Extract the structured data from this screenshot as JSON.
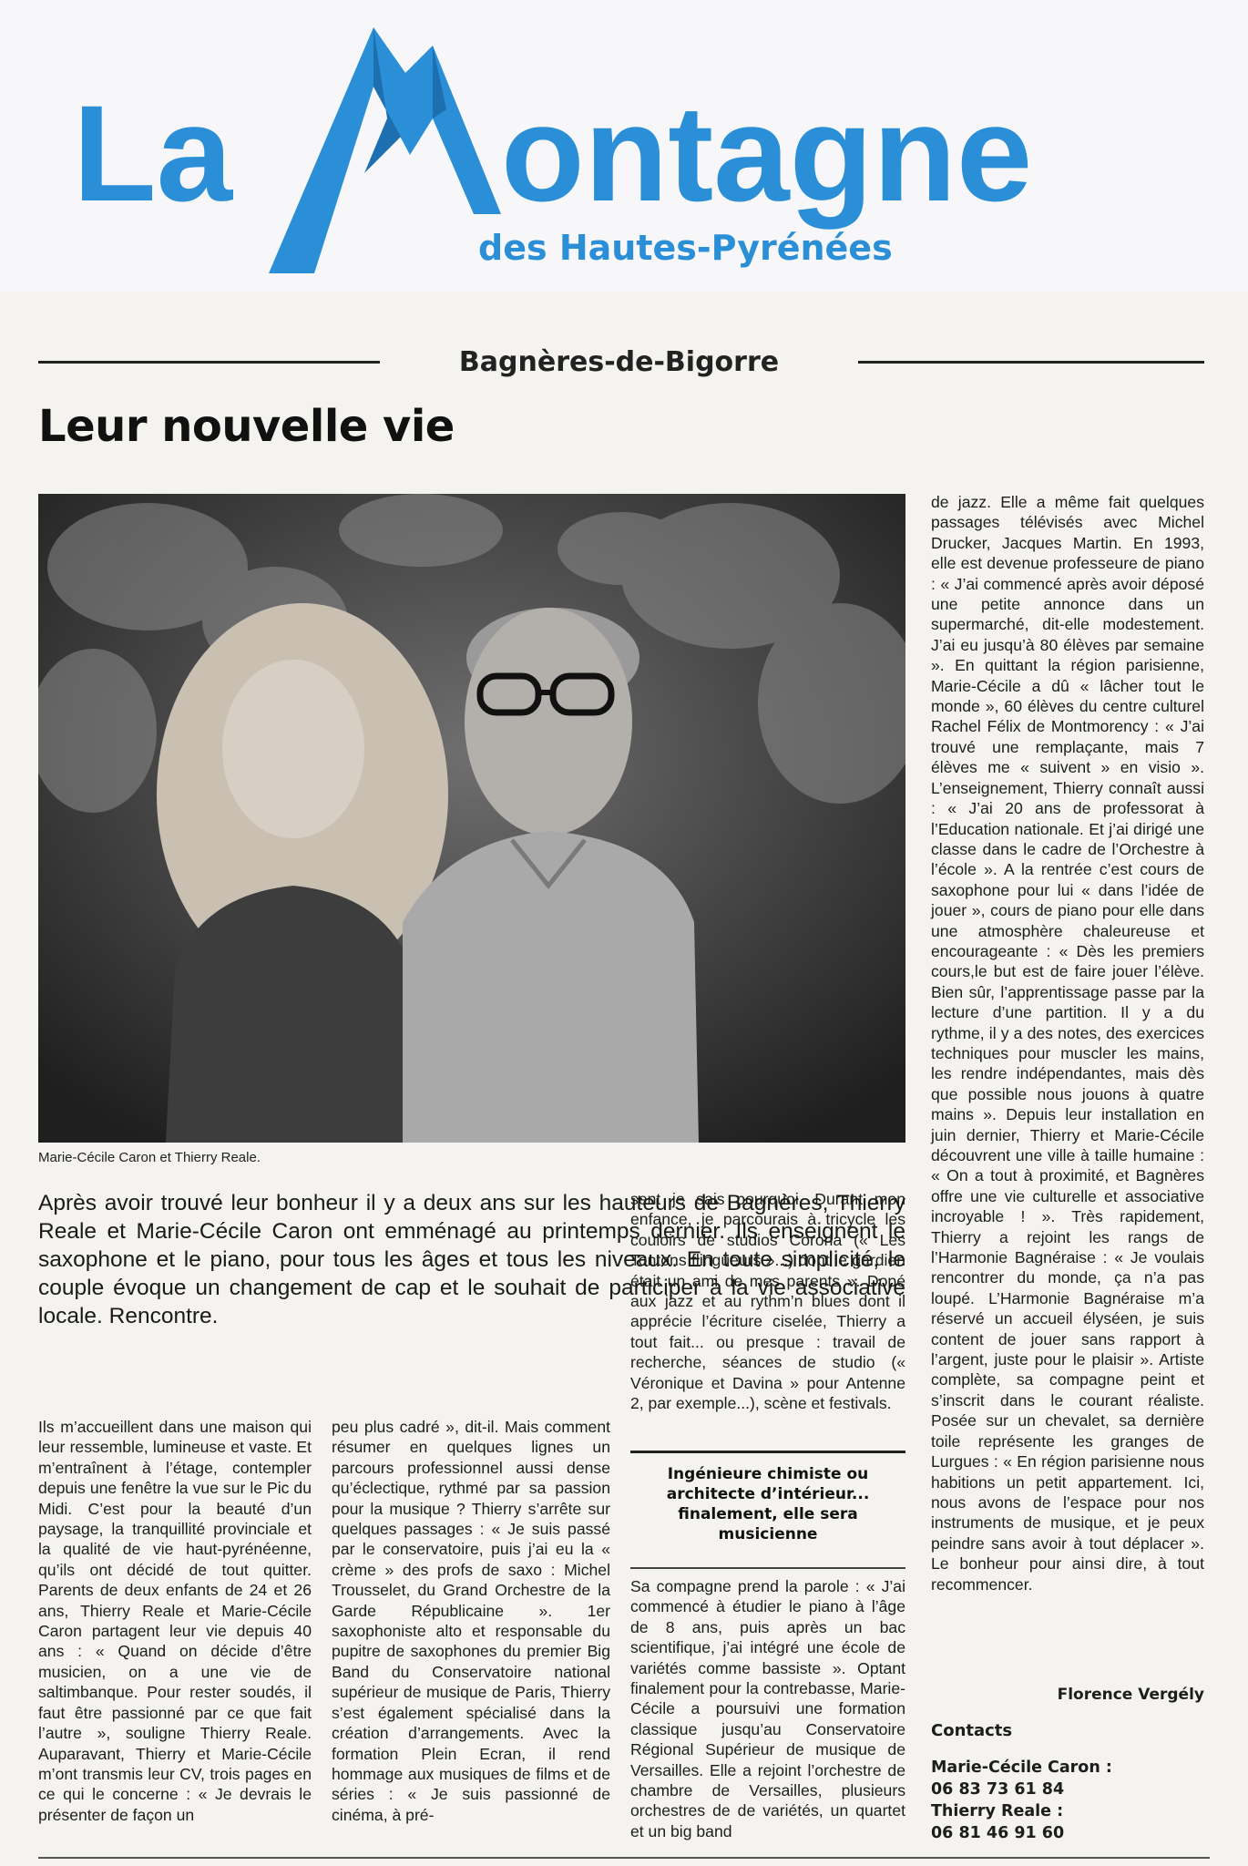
{
  "masthead": {
    "title_la": "La",
    "title_ontagne": "ontagne",
    "subtitle": "des Hautes-Pyrénées",
    "logo_color": "#2a8fd6"
  },
  "section": "Bagnères-de-Bigorre",
  "headline": "Leur nouvelle vie",
  "photo": {
    "caption": "Marie-Cécile Caron et Thierry Reale."
  },
  "lead": "Après avoir trouvé leur bonheur il y a deux ans sur les hauteurs de Bagnères, Thierry Reale et Marie-Cécile Caron ont emménagé au printemps dernier. Ils enseignent le saxophone et le piano, pour tous les âges et tous les niveaux. En toute simplicité, le couple évoque un changement de cap et le souhait de participer à la vie associative locale. Rencontre.",
  "columns": {
    "col1": "Ils m’accueillent dans une maison qui leur ressemble, lumineuse et vaste. Et m’entraînent à l’étage, contempler depuis une fenêtre la vue sur le Pic du Midi. C’est pour la beauté d’un paysage, la tranquillité provinciale et la qualité de vie haut-pyrénéenne, qu’ils ont décidé de tout quitter. Parents de deux enfants de 24 et 26 ans, Thierry Reale et Marie-Cécile Caron partagent leur vie depuis 40 ans : « Quand on décide d’être musicien, on a une vie de saltimbanque. Pour rester soudés, il faut être passionné par ce que fait l’autre », souligne Thierry Reale. Auparavant, Thierry et Marie-Cécile m’ont transmis leur CV, trois pages en ce qui le concerne : « Je devrais le présenter de façon un",
    "col2": "peu plus cadré », dit-il. Mais comment résumer en quelques lignes un parcours professionnel aussi dense qu’éclectique, rythmé par sa passion pour la musique ? Thierry s’arrête sur quelques passages : « Je suis passé par le conservatoire, puis j’ai eu la « crème » des profs de saxo : Michel Trousselet, du Grand Orchestre de la Garde Républicaine ». 1er saxophoniste alto et responsable du pupitre de saxophones du premier Big Band du Conservatoire national supérieur de musique de Paris, Thierry s’est également spécialisé dans la création d’arrangements. Avec la formation Plein Ecran, il rend hommage aux musiques de films et de séries : « Je suis passionné de cinéma, à pré-",
    "col3a": "sent je sais pourquoi. Durant mon enfance, je parcourais à tricycle les couloirs de studios Corona (« Les Tontons flingueurs »...) dont le gardien était un ami de mes parents ». Dopé aux jazz et au rythm’n blues dont il apprécie l’écriture ciselée, Thierry a tout fait... ou presque : travail de recherche, séances de studio (« Véronique et Davina » pour Antenne 2, par exemple...), scène et festivals.",
    "subhead": "Ingénieure chimiste ou architecte d’intérieur... finalement, elle sera musicienne",
    "col3b": "Sa compagne prend la parole : « J’ai commencé à étudier le piano à l’âge de 8 ans, puis après un bac scientifique, j’ai intégré une école de variétés comme bassiste ». Optant finalement pour la contrebasse, Marie-Cécile a poursuivi une formation classique jusqu’au Conservatoire Régional Supérieur de musique de Versailles. Elle a rejoint l’orchestre de chambre de Versailles, plusieurs orchestres de de variétés, un quartet et un big band",
    "col4": "de jazz. Elle a même fait quelques passages télévisés avec Michel Drucker, Jacques Martin. En 1993, elle est devenue professeure de piano : « J’ai commencé après avoir déposé une petite annonce dans un supermarché, dit-elle modestement. J’ai eu jusqu’à 80 élèves par semaine ». En quittant la région parisienne, Marie-Cécile a dû « lâcher tout le monde », 60 élèves du centre culturel Rachel Félix de Montmorency : « J’ai trouvé une remplaçante, mais 7 élèves me « suivent » en visio ». L’enseignement, Thierry connaît aussi : « J’ai 20 ans de professorat à l’Education nationale. Et j’ai dirigé une classe dans le cadre de l’Orchestre à l’école ». A la rentrée c’est cours de saxophone pour lui « dans l’idée de jouer », cours de piano pour elle dans une atmosphère chaleureuse et encourageante : « Dès les premiers cours,le but est de faire jouer l’élève. Bien sûr, l’apprentissage passe par la lecture d’une partition. Il y a du rythme, il y a des notes, des exercices techniques pour muscler les mains, les rendre indépendantes, mais dès que possible nous jouons à quatre mains ». Depuis leur installation en juin dernier, Thierry et Marie-Cécile découvrent une ville à taille humaine : « On a tout à proximité, et Bagnères offre une vie culturelle et associative incroyable ! ». Très rapidement, Thierry a rejoint les rangs de l’Harmonie Bagnéraise : « Je voulais rencontrer du monde, ça n’a pas loupé. L’Harmonie Bagnéraise m’a réservé un accueil élyséen, je suis content de jouer sans rapport à l’argent, juste pour le plaisir ». Artiste complète, sa compagne peint et s’inscrit dans le courant réaliste. Posée sur un chevalet, sa dernière toile représente les granges de Lurgues : « En région parisienne nous habitions un petit appartement. Ici, nous avons de l’espace pour nos instruments de musique, et je peux peindre sans avoir à tout déplacer ». Le bonheur pour ainsi dire, à tout recommencer."
  },
  "signature": "Florence Vergély",
  "contacts": {
    "title": "Contacts",
    "entries": [
      {
        "name": "Marie-Cécile Caron :",
        "phone": "06 83 73 61 84"
      },
      {
        "name": "Thierry Reale :",
        "phone": "06 81 46 91 60"
      }
    ]
  }
}
